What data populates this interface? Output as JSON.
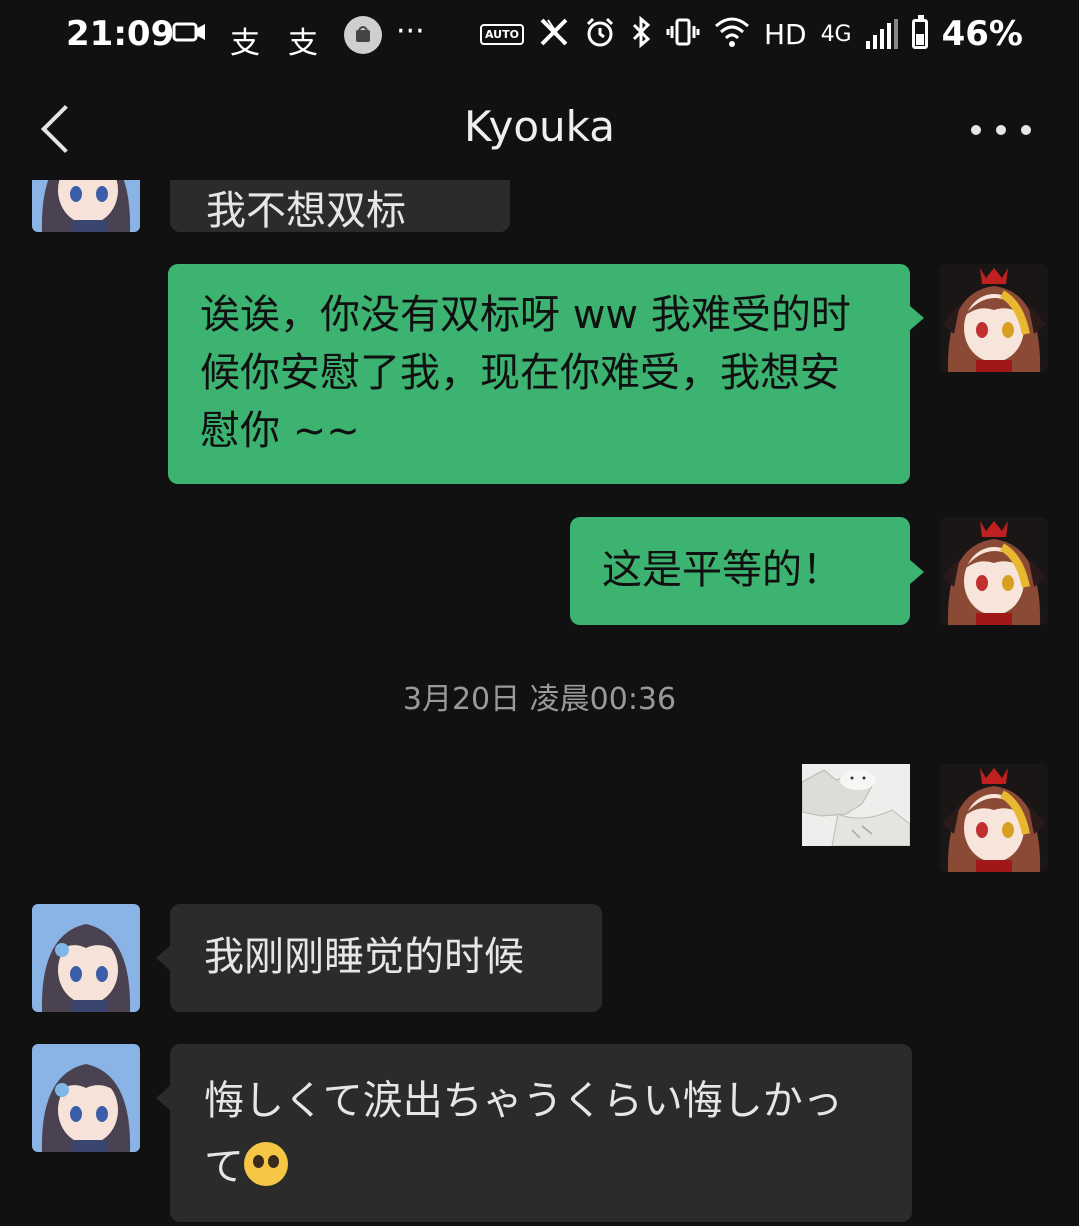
{
  "status_bar": {
    "time": "21:09",
    "notif_1": "支",
    "notif_2": "支",
    "dots": "···",
    "auto_label": "AUTO",
    "network": "HD",
    "net_type": "4G",
    "battery": "46%",
    "battery_level": 0.46
  },
  "header": {
    "title": "Kyouka"
  },
  "messages": [
    {
      "sender": "other",
      "text": "我不想双标"
    },
    {
      "sender": "me",
      "text": "诶诶，你没有双标呀 ww 我难受的时候你安慰了我，现在你难受，我想安慰你 ~~"
    },
    {
      "sender": "me",
      "text": "这是平等的！"
    },
    {
      "sender": "me",
      "type": "sticker"
    },
    {
      "sender": "other",
      "text": "我刚刚睡觉的时候"
    },
    {
      "sender": "other",
      "text": "悔しくて涙出ちゃうくらい悔しかって"
    }
  ],
  "timestamp": "3月20日 凌晨00:36",
  "colors": {
    "background": "#111111",
    "my_bubble": "#3cb371",
    "other_bubble": "#2b2b2b"
  }
}
